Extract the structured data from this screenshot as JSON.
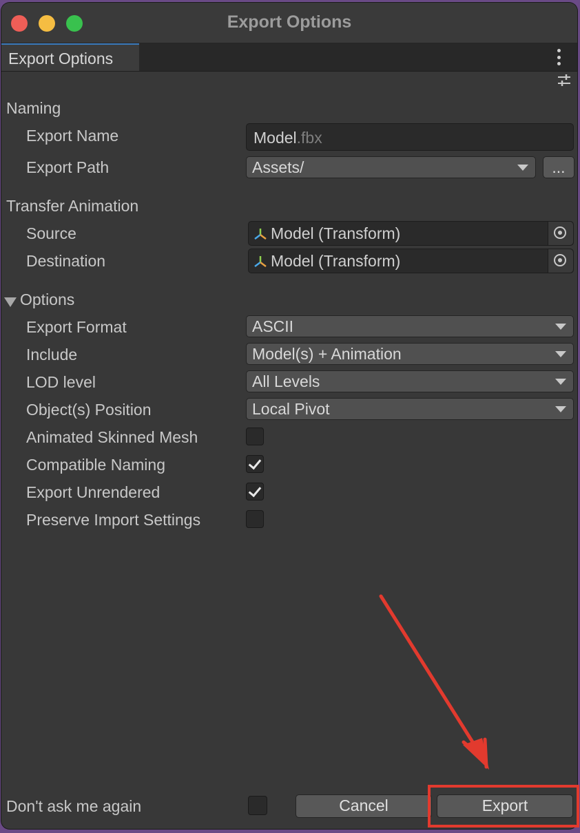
{
  "window": {
    "title": "Export Options"
  },
  "tab": {
    "label": "Export Options"
  },
  "naming": {
    "section": "Naming",
    "export_name_label": "Export Name",
    "export_name_value": "Model",
    "export_name_ext": ".fbx",
    "export_path_label": "Export Path",
    "export_path_value": "Assets/",
    "browse_label": "..."
  },
  "transfer": {
    "section": "Transfer Animation",
    "source_label": "Source",
    "source_value": "Model (Transform)",
    "destination_label": "Destination",
    "destination_value": "Model (Transform)"
  },
  "options": {
    "section": "Options",
    "export_format_label": "Export Format",
    "export_format_value": "ASCII",
    "include_label": "Include",
    "include_value": "Model(s) + Animation",
    "lod_label": "LOD level",
    "lod_value": "All Levels",
    "position_label": "Object(s) Position",
    "position_value": "Local Pivot",
    "animated_skinned_label": "Animated Skinned Mesh",
    "animated_skinned_checked": false,
    "compatible_naming_label": "Compatible Naming",
    "compatible_naming_checked": true,
    "export_unrendered_label": "Export Unrendered",
    "export_unrendered_checked": true,
    "preserve_import_label": "Preserve Import Settings",
    "preserve_import_checked": false
  },
  "footer": {
    "dont_ask_label": "Don't ask me again",
    "dont_ask_checked": false,
    "cancel_label": "Cancel",
    "export_label": "Export"
  },
  "annotation": {
    "color": "#e23a2e"
  }
}
